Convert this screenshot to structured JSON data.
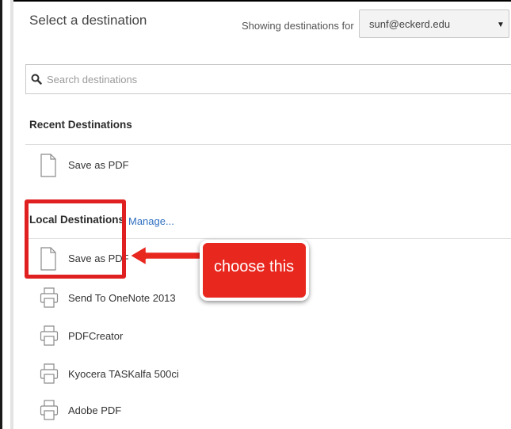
{
  "header": {
    "title": "Select a destination",
    "showing_label": "Showing destinations for",
    "account": "sunf@eckerd.edu"
  },
  "search": {
    "placeholder": "Search destinations",
    "value": ""
  },
  "recent": {
    "heading": "Recent Destinations",
    "items": [
      {
        "label": "Save as PDF",
        "icon": "document-icon"
      }
    ]
  },
  "local": {
    "heading": "Local Destinations",
    "manage_label": "Manage...",
    "items": [
      {
        "label": "Save as PDF",
        "icon": "document-icon"
      },
      {
        "label": "Send To OneNote 2013",
        "icon": "printer-icon"
      },
      {
        "label": "PDFCreator",
        "icon": "printer-icon"
      },
      {
        "label": "Kyocera TASKalfa 500ci",
        "icon": "printer-icon"
      },
      {
        "label": "Adobe PDF",
        "icon": "printer-icon"
      }
    ]
  },
  "annotation": {
    "callout_text": "choose this",
    "highlight_color": "#e02020",
    "callout_color": "#e8271f"
  }
}
